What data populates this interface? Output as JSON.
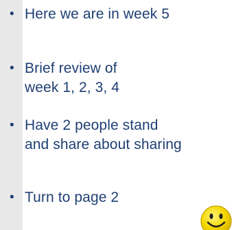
{
  "slide": {
    "bullets": [
      {
        "text": "Here we are in week 5"
      },
      {
        "text": "Brief review of\nweek 1, 2, 3, 4"
      },
      {
        "text": "Have 2 people stand\nand share about sharing"
      },
      {
        "text": "Turn to page 2"
      }
    ],
    "bullet_glyph": "•",
    "decoration": {
      "icon": "smiley-face-icon",
      "face_color": "#f5d800",
      "outline_color": "#c8a400"
    },
    "colors": {
      "text": "#1f3f73",
      "left_band": "#e8e8e8",
      "background": "#ffffff"
    }
  }
}
